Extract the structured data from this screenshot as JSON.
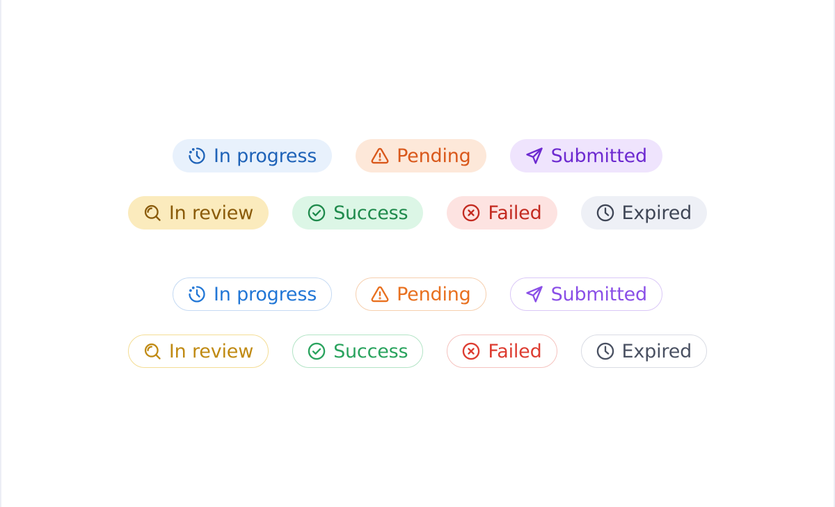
{
  "badges": {
    "in_progress": "In progress",
    "pending": "Pending",
    "submitted": "Submitted",
    "in_review": "In review",
    "success": "Success",
    "failed": "Failed",
    "expired": "Expired"
  },
  "icons": {
    "in_progress": "progress-clock-icon",
    "pending": "warning-triangle-icon",
    "submitted": "send-arrow-icon",
    "in_review": "search-icon",
    "success": "check-circle-icon",
    "failed": "x-circle-icon",
    "expired": "clock-icon"
  },
  "colors": {
    "in_progress": "#1f63b8",
    "pending": "#d9581b",
    "submitted": "#6d2ad0",
    "in_review": "#8a5b0a",
    "success": "#1f8a4c",
    "failed": "#c32a20",
    "expired": "#3f4656"
  }
}
